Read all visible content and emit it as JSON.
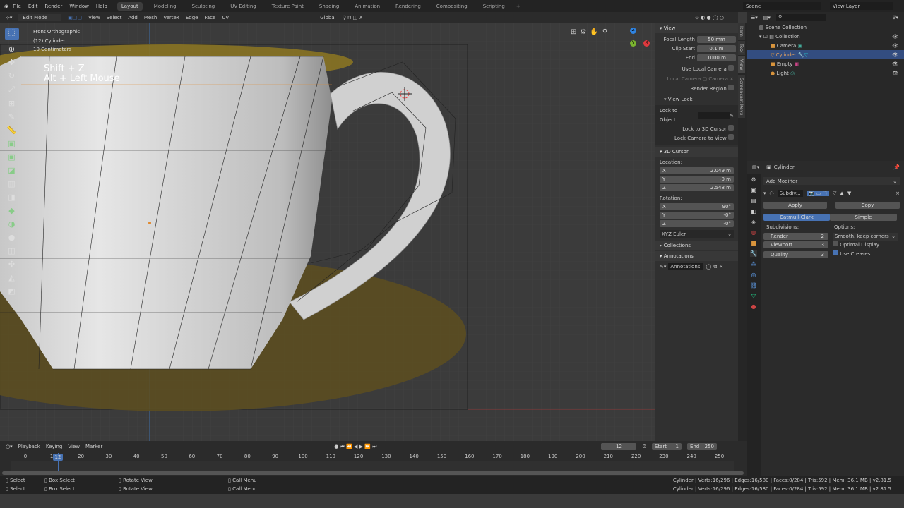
{
  "topbar": {
    "menus": [
      "File",
      "Edit",
      "Render",
      "Window",
      "Help"
    ],
    "workspaces": [
      "Layout",
      "Modeling",
      "Sculpting",
      "UV Editing",
      "Texture Paint",
      "Shading",
      "Animation",
      "Rendering",
      "Compositing",
      "Scripting"
    ],
    "active_workspace": "Layout",
    "scene": "Scene",
    "view_layer": "View Layer"
  },
  "viewport_header": {
    "mode": "Edit Mode",
    "menus": [
      "View",
      "Select",
      "Add",
      "Mesh",
      "Vertex",
      "Edge",
      "Face",
      "UV"
    ],
    "orientation": "Global"
  },
  "viewport": {
    "view_name": "Front Orthographic",
    "object": "(12) Cylinder",
    "scale": "10 Centimeters",
    "screencast_keys": [
      "Shift + Z",
      "Alt + Left Mouse"
    ],
    "gizmo_axes": [
      "X",
      "Y",
      "Z"
    ]
  },
  "npanel": {
    "tabs": [
      "Item",
      "Tool",
      "View",
      "Screencast Keys"
    ],
    "active_tab": "View",
    "view": {
      "title": "View",
      "focal_length_label": "Focal Length",
      "focal_length": "50 mm",
      "clip_start_label": "Clip Start",
      "clip_start": "0.1 m",
      "end_label": "End",
      "end": "1000 m",
      "use_local_camera": "Use Local Camera",
      "local_camera_label": "Local Camera",
      "local_camera": "Camera",
      "render_region": "Render Region"
    },
    "view_lock": {
      "title": "View Lock",
      "lock_to_object": "Lock to Object",
      "lock_to_cursor": "Lock to 3D Cursor",
      "lock_camera": "Lock Camera to View"
    },
    "cursor": {
      "title": "3D Cursor",
      "location_label": "Location:",
      "location": [
        {
          "axis": "X",
          "value": "2.049 m"
        },
        {
          "axis": "Y",
          "value": "-0 m"
        },
        {
          "axis": "Z",
          "value": "2.548 m"
        }
      ],
      "rotation_label": "Rotation:",
      "rotation": [
        {
          "axis": "X",
          "value": "90°"
        },
        {
          "axis": "Y",
          "value": "-0°"
        },
        {
          "axis": "Z",
          "value": "-0°"
        }
      ],
      "rotation_mode": "XYZ Euler"
    },
    "collections": "Collections",
    "annotations": "Annotations",
    "annotation_layer": "Annotations"
  },
  "outliner": {
    "root": "Scene Collection",
    "items": [
      {
        "name": "Collection",
        "level": 1
      },
      {
        "name": "Camera",
        "level": 2
      },
      {
        "name": "Cylinder",
        "level": 2,
        "selected": true
      },
      {
        "name": "Empty",
        "level": 2
      },
      {
        "name": "Light",
        "level": 2
      }
    ]
  },
  "properties": {
    "object": "Cylinder",
    "add_modifier": "Add Modifier",
    "modifier_name": "Subdiv...",
    "apply": "Apply",
    "copy": "Copy",
    "catmull": "Catmull-Clark",
    "simple": "Simple",
    "subdivisions_label": "Subdivisions:",
    "render_label": "Render",
    "render": "2",
    "viewport_label": "Viewport",
    "viewport": "3",
    "quality_label": "Quality",
    "quality": "3",
    "options_label": "Options:",
    "uv_smooth": "Smooth, keep corners",
    "optimal_display": "Optimal Display",
    "use_creases": "Use Creases"
  },
  "timeline": {
    "menus": [
      "Playback",
      "Keying",
      "View",
      "Marker"
    ],
    "current_frame": "12",
    "start_label": "Start",
    "start": "1",
    "end_label": "End",
    "end": "250",
    "ticks": [
      "0",
      "10",
      "20",
      "30",
      "40",
      "50",
      "60",
      "70",
      "80",
      "90",
      "100",
      "110",
      "120",
      "130",
      "140",
      "150",
      "160",
      "170",
      "180",
      "190",
      "200",
      "210",
      "220",
      "230",
      "240",
      "250"
    ]
  },
  "status": {
    "hints": [
      "Select",
      "Box Select",
      "Rotate View",
      "Call Menu"
    ],
    "stats": "Cylinder | Verts:16/296 | Edges:16/580 | Faces:0/284 | Tris:592 | Mem: 36.1 MB | v2.81.5"
  },
  "colors": {
    "accent": "#4772b3",
    "selected_row": "#334d80",
    "edge_select": "#e08a30",
    "saucer": "#6b5a1e"
  }
}
